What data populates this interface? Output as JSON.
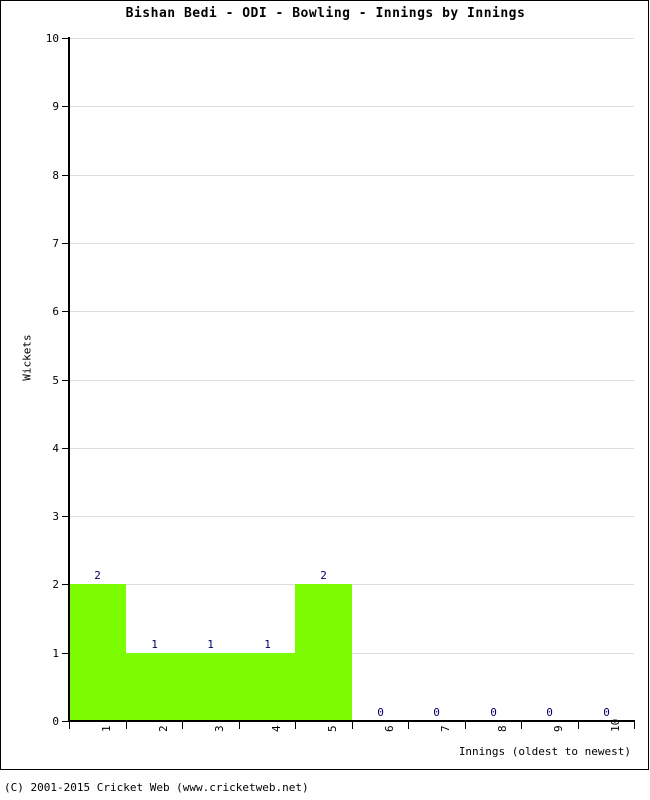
{
  "chart_data": {
    "type": "bar",
    "title": "Bishan Bedi - ODI - Bowling - Innings by Innings",
    "xlabel": "Innings (oldest to newest)",
    "ylabel": "Wickets",
    "categories": [
      "1",
      "2",
      "3",
      "4",
      "5",
      "6",
      "7",
      "8",
      "9",
      "10"
    ],
    "values": [
      2,
      1,
      1,
      1,
      2,
      0,
      0,
      0,
      0,
      0
    ],
    "value_labels": [
      "2",
      "1",
      "1",
      "1",
      "2",
      "0",
      "0",
      "0",
      "0",
      "0"
    ],
    "ylim": [
      0,
      10
    ],
    "y_ticks": [
      0,
      1,
      2,
      3,
      4,
      5,
      6,
      7,
      8,
      9,
      10
    ],
    "y_tick_labels": [
      "0",
      "1",
      "2",
      "3",
      "4",
      "5",
      "6",
      "7",
      "8",
      "9",
      "10"
    ],
    "grid": true,
    "grid_color": "#dddddd",
    "bar_color": "#7cfc00",
    "value_label_color": "#000066",
    "legend": null,
    "series": [
      {
        "name": "Wickets",
        "values": [
          2,
          1,
          1,
          1,
          2,
          0,
          0,
          0,
          0,
          0
        ]
      }
    ]
  },
  "footer": {
    "copyright": "(C) 2001-2015 Cricket Web (www.cricketweb.net)"
  }
}
